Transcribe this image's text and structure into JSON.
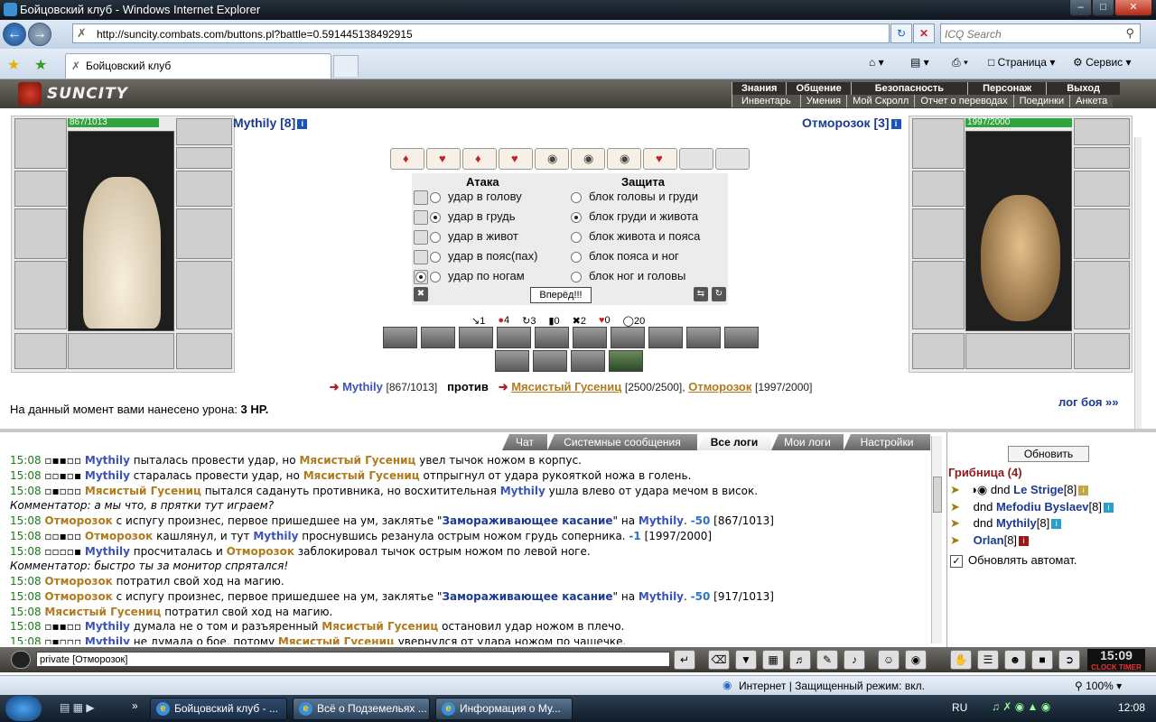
{
  "window": {
    "title": "Бойцовский клуб - Windows Internet Explorer"
  },
  "browser": {
    "url": "http://suncity.combats.com/buttons.pl?battle=0.591445138492915",
    "search_placeholder": "ICQ Search",
    "tab_title": "Бойцовский клуб",
    "toolbar": {
      "page": "Страница",
      "service": "Сервис"
    }
  },
  "site": {
    "logo": "SUNCITY",
    "menu_top": [
      "Знания",
      "Общение",
      "Безопасность",
      "Персонаж",
      "Выход"
    ],
    "menu_bottom": [
      "Инвентарь",
      "Умения",
      "Мой Скролл",
      "Отчет о переводах",
      "Поединки",
      "Анкета"
    ]
  },
  "battle": {
    "left": {
      "name": "Mythily [8]",
      "hp_text": "867/1013",
      "hp_fraction": 0.856
    },
    "right": {
      "name": "Отморозок [3]",
      "hp_text": "1997/2000",
      "hp_fraction": 0.998
    },
    "attack_header": "Атака",
    "defense_header": "Защита",
    "attacks": [
      "удар в голову",
      "удар в грудь",
      "удар в живот",
      "удар в пояс(пах)",
      "удар по ногам"
    ],
    "defenses": [
      "блок головы и груди",
      "блок груди и живота",
      "блок живота и пояса",
      "блок пояса и ног",
      "блок ног и головы"
    ],
    "selected_attack": 1,
    "selected_defense": 1,
    "go_button": "Вперёд!!!",
    "stats": [
      "1",
      "4",
      "3",
      "0",
      "2",
      "0",
      "20"
    ],
    "vs": {
      "player": "Mythily",
      "player_hp": "[867/1013]",
      "against": "против",
      "enemy1": "Мясистый Гусениц",
      "enemy1_hp": "[2500/2500],",
      "enemy2": "Отморозок",
      "enemy2_hp": "[1997/2000]"
    },
    "damage_label": "На данный момент вами нанесено урона:",
    "damage_value": "3 HP.",
    "log_link": "лог боя »»"
  },
  "chat": {
    "tabs": [
      "Чат",
      "Системные сообщения",
      "Все логи",
      "Мои логи",
      "Настройки"
    ],
    "active_tab": 2,
    "input_value": "private [Отморозок]"
  },
  "sidebar": {
    "refresh_button": "Обновить",
    "room": "Грибница (4)",
    "players": [
      {
        "prefix": "dnd",
        "name": "Le Strige",
        "level": "[8]"
      },
      {
        "prefix": "dnd",
        "name": "Mefodiu Byslaev",
        "level": "[8]"
      },
      {
        "prefix": "dnd",
        "name": "Mythily",
        "level": "[8]"
      },
      {
        "prefix": "",
        "name": "Orlan",
        "level": "[8]"
      }
    ],
    "auto_refresh": "Обновлять автомат."
  },
  "clock": {
    "time": "15:09",
    "label": "CLOCK TIMER"
  },
  "statusbar": {
    "zone": "Интернет | Защищенный режим: вкл.",
    "zoom": "100%"
  },
  "taskbar": {
    "tasks": [
      "Бойцовский клуб - ...",
      "Всё о Подземельях ...",
      "Информация о Му..."
    ],
    "lang": "RU",
    "time": "12:08"
  }
}
